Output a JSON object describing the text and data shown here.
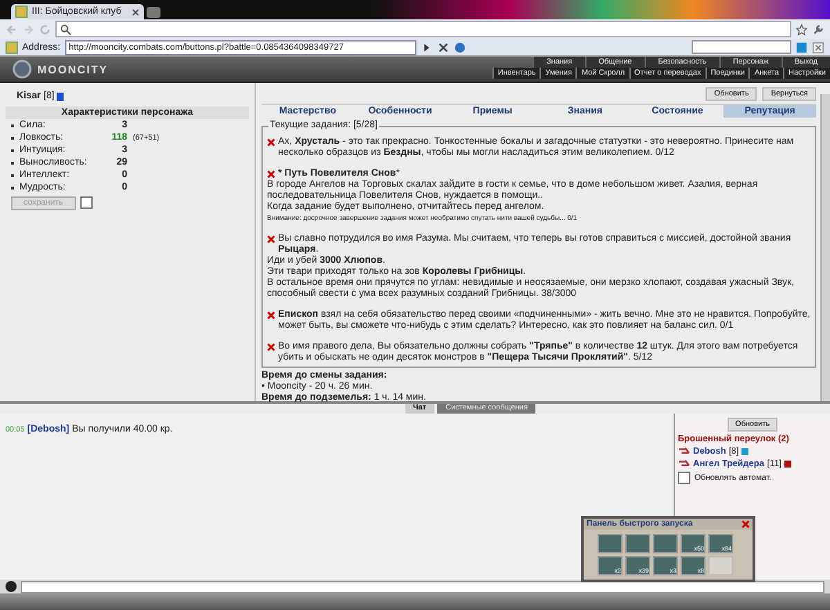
{
  "browser": {
    "tab_title": "III: Бойцовский клуб",
    "address_label": "Address:",
    "url": "http://mooncity.combats.com/buttons.pl?battle=0.0854364098349727"
  },
  "header": {
    "logo": "MOONCITY",
    "nav": [
      "Знания",
      "Общение",
      "Безопасность",
      "Персонаж",
      "Выход"
    ],
    "subnav": [
      "Инвентарь",
      "Умения",
      "Мой Скролл",
      "Отчет о переводах",
      "Поединки",
      "Анкета",
      "Настройки"
    ]
  },
  "character": {
    "name": "Kisar",
    "level": "[8]",
    "panel_title": "Характеристики персонажа",
    "stats": [
      {
        "label": "Сила:",
        "value": "3",
        "kind": "base"
      },
      {
        "label": "Ловкость:",
        "value": "118",
        "extra": "(67+51)",
        "kind": "boosted"
      },
      {
        "label": "Интуиция:",
        "value": "3",
        "kind": "base"
      },
      {
        "label": "Выносливость:",
        "value": "29",
        "kind": "base"
      },
      {
        "label": "Интеллект:",
        "value": "0",
        "kind": "base"
      },
      {
        "label": "Мудрость:",
        "value": "0",
        "kind": "base"
      }
    ],
    "save_button": {
      "label": "сохранить",
      "disabled": true
    },
    "save_checkbox": {
      "checked": false
    }
  },
  "page_buttons": [
    "Обновить",
    "Вернуться"
  ],
  "tabs": [
    {
      "label": "Мастерство",
      "selected": false
    },
    {
      "label": "Особенности",
      "selected": false
    },
    {
      "label": "Приемы",
      "selected": false
    },
    {
      "label": "Знания",
      "selected": false
    },
    {
      "label": "Состояние",
      "selected": false
    },
    {
      "label": "Репутация",
      "selected": true
    }
  ],
  "quests": {
    "legend": "Текущие задания: [5/28]",
    "items": [
      {
        "paragraphs": [
          {
            "kind": "text",
            "text": "Ах, **Хрусталь** - это так прекрасно. Тонкостенные бокалы и загадочные статуэтки - это невероятно. Принесите нам несколько образцов из **Бездны**, чтобы мы могли насладиться этим великолепием. 0/12"
          }
        ]
      },
      {
        "paragraphs": [
          {
            "kind": "text",
            "text": "*** Путь Повелителя Снов***"
          },
          {
            "kind": "text",
            "text": "В городе Ангелов на Торговых скалах зайдите в гости к семье, что в доме небольшом живет. Азалия, верная последовательница Повелителя Снов, нуждается в помощи.."
          },
          {
            "kind": "text",
            "text": "Когда задание будет выполнено, отчитайтесь перед ангелом."
          },
          {
            "kind": "note",
            "text": "Внимание: досрочное завершение задания может необратимо спутать нити вашей судьбы... 0/1"
          }
        ]
      },
      {
        "paragraphs": [
          {
            "kind": "text",
            "text": "Вы славно потрудился во имя Разума. Мы считаем, что теперь вы готов справиться с миссией, достойной звания **Рыцаря**."
          },
          {
            "kind": "text",
            "text": "Иди и убей **3000 Хлюпов**."
          },
          {
            "kind": "text",
            "text": "Эти твари приходят только на зов **Королевы Грибницы**."
          },
          {
            "kind": "text",
            "text": "В остальное время они прячутся по углам: невидимые и неосязаемые, они мерзко хлопают, создавая ужасный Звук, способный свести с ума всех разумных созданий Грибницы. 38/3000"
          }
        ]
      },
      {
        "paragraphs": [
          {
            "kind": "text",
            "text": "**Епископ** взял на себя обязательство перед своими «подчиненными» - жить вечно. Мне это не нравится. Попробуйте, может быть, вы сможете что-нибудь с этим сделать? Интересно, как это повлияет на баланс сил. 0/1"
          }
        ]
      },
      {
        "paragraphs": [
          {
            "kind": "text",
            "text": "Во имя правого дела, Вы обязательно должны собрать **\"Тряпье\"** в количестве **12** штук. Для этого вам потребуется убить и обыскать не один десяток монстров в **\"Пещера Тысячи Проклятий\"**. 5/12"
          }
        ]
      }
    ]
  },
  "timers": [
    "**Время до смены задания:**",
    "• Mooncity - 20 ч. 26 мин.",
    "**Время до подземелья:** 1 ч. 14 мин."
  ],
  "chat": {
    "tabs": [
      {
        "label": "Чат",
        "selected": true
      },
      {
        "label": "Системные сообщения",
        "selected": false
      }
    ],
    "messages": [
      {
        "time": "00:05",
        "user": "[Debosh]",
        "text": "Вы получили 40.00 кр."
      }
    ]
  },
  "location": {
    "refresh": "Обновить",
    "title": "Брошенный переулок (2)",
    "users": [
      {
        "name": "Debosh",
        "level": "[8]",
        "color": "#1a9fd0"
      },
      {
        "name": "Ангел Трейдера",
        "level": "[11]",
        "color": "#b01010"
      }
    ],
    "auto_refresh": {
      "label": "Обновлять автомат.",
      "checked": false
    }
  },
  "quick_panel": {
    "title": "Панель быстрого запуска",
    "slots": [
      {
        "kind": "item"
      },
      {
        "kind": "item"
      },
      {
        "kind": "item"
      },
      {
        "kind": "item",
        "count": "x50"
      },
      {
        "kind": "item",
        "count": "x84"
      },
      {
        "kind": "item",
        "count": "x2"
      },
      {
        "kind": "item",
        "count": "x39"
      },
      {
        "kind": "item",
        "count": "x3"
      },
      {
        "kind": "item",
        "count": "x8"
      },
      {
        "kind": "empty"
      }
    ]
  }
}
